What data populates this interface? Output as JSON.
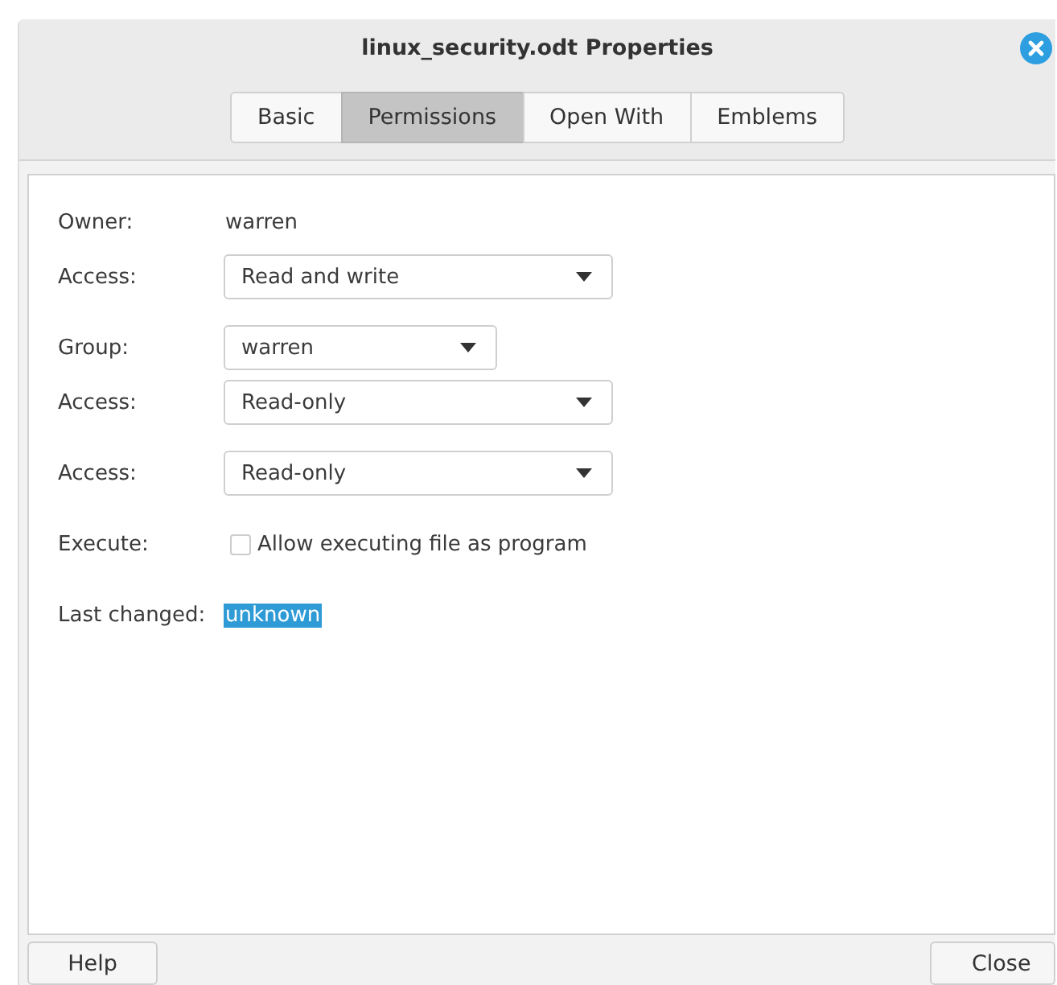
{
  "window": {
    "title": "linux_security.odt Properties"
  },
  "tabs": [
    {
      "label": "Basic",
      "selected": false
    },
    {
      "label": "Permissions",
      "selected": true
    },
    {
      "label": "Open With",
      "selected": false
    },
    {
      "label": "Emblems",
      "selected": false
    }
  ],
  "sections": [
    {
      "rows": [
        {
          "kind": "text",
          "label": "Owner:",
          "value": "warren"
        },
        {
          "kind": "dropdown",
          "label": "Access:",
          "value": "Read and write",
          "wide": true
        }
      ]
    },
    {
      "rows": [
        {
          "kind": "dropdown",
          "label": "Group:",
          "value": "warren",
          "wide": false
        },
        {
          "kind": "dropdown",
          "label": "Access:",
          "value": "Read-only",
          "wide": true
        }
      ]
    },
    {
      "rows": [
        {
          "kind": "dropdown",
          "label": "Access:",
          "value": "Read-only",
          "wide": true
        }
      ]
    },
    {
      "rows": [
        {
          "kind": "checkbox",
          "label": "Execute:",
          "value": "Allow executing file as program",
          "checked": false
        }
      ]
    },
    {
      "rows": [
        {
          "kind": "text",
          "label": "Last changed:",
          "value": "unknown",
          "highlighted": true
        }
      ]
    }
  ],
  "buttons": [
    "Help",
    "Close"
  ]
}
